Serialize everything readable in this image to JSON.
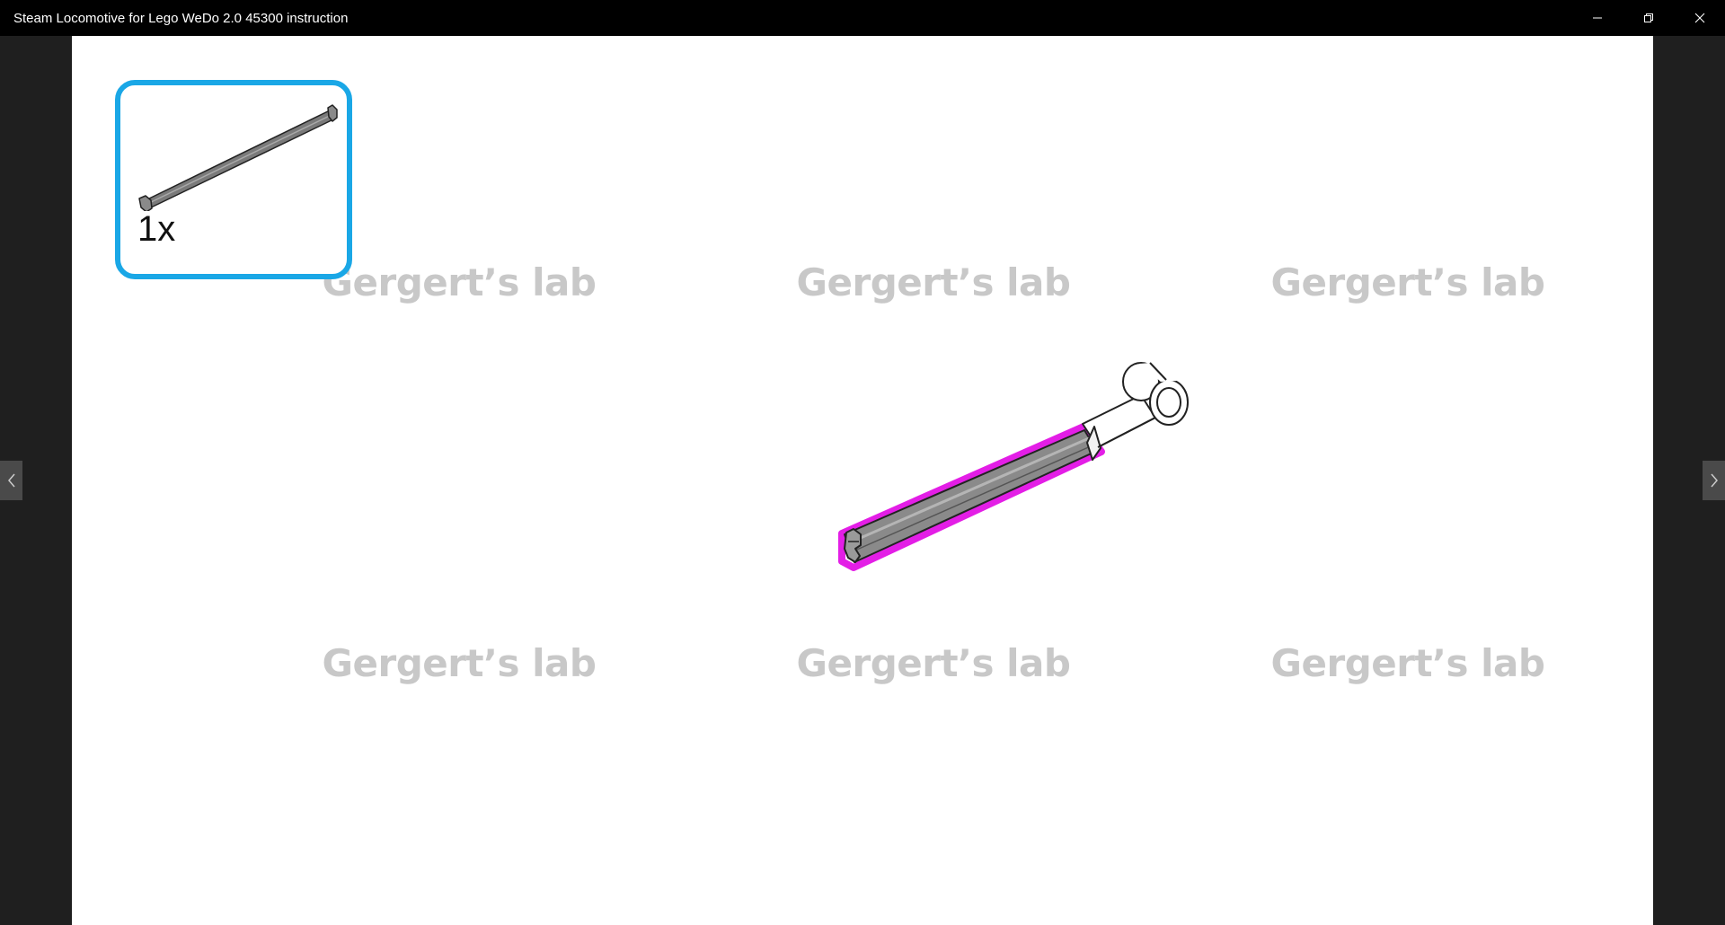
{
  "window": {
    "title": "Steam Locomotive for Lego WeDo 2.0 45300 instruction",
    "controls": [
      "minimize-icon",
      "restore-icon",
      "close-icon"
    ]
  },
  "step": {
    "parts_list": [
      {
        "part": "axle",
        "color": "#6e6e6e",
        "count": "1x"
      }
    ],
    "highlight_color": "#e31ee6",
    "frame_color": "#1aa7e6"
  },
  "watermarks": [
    "Gergert’s lab",
    "Gergert’s lab",
    "Gergert’s lab",
    "Gergert’s lab",
    "Gergert’s lab",
    "Gergert’s lab"
  ],
  "navigation": {
    "prev_icon": "chevron-left-icon",
    "next_icon": "chevron-right-icon"
  }
}
